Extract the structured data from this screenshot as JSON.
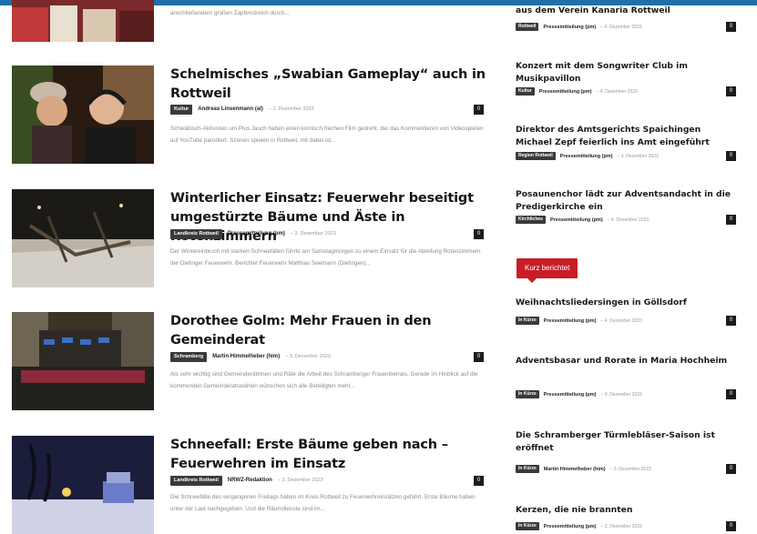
{
  "top_article_excerpt": "anschließendem großen Zapfenstreich durch...",
  "articles": [
    {
      "title": "Schelmisches „Swabian Gameplay“ auch in Rottweil",
      "category": "Kultur",
      "author": "Andreas Linsenmann (al)",
      "date": "3. Dezember 2023",
      "comments": "0",
      "excerpt": "Schwäbisch-Aktivisten um Plus Jauch haben einen komisch-frechen Film gedreht, der das Kommentieren von Videospielen auf YouTube parodiert. Szenen spielen in Rottweil, mit dabei ist..."
    },
    {
      "title": "Winterlicher Einsatz: Feuerwehr beseitigt umgestürzte Bäume und Äste in Rotenzimmern",
      "category": "Landkreis Rottweil",
      "author": "Pressemitteilung (pm)",
      "date": "3. Dezember 2023",
      "comments": "0",
      "excerpt": "Der Wintereinbruch mit starken Schneefällen führte am Samstagmorgen zu einem Einsatz für die Abteilung Rotenzimmern der Dietinger Feuerwehr. Berichtet Feuerwehr Matthias Seemann (Dietingen)..."
    },
    {
      "title": "Dorothee Golm: Mehr Frauen in den Gemeinderat",
      "category": "Schramberg",
      "author": "Martin Himmelheber (him)",
      "date": "3. Dezember 2023",
      "comments": "0",
      "excerpt": "Als sehr wichtig sind Gemeinderätinnen und Räte die Arbeit des Schramberger Frauenbeirats. Gerade im Hinblick auf die kommenden Gemeinderatswahlen wünschen sich alle Beteiligten mehr..."
    },
    {
      "title": "Schneefall: Erste Bäume geben nach – Feuerwehren im Einsatz",
      "category": "Landkreis Rottweil",
      "author": "NRWZ-Redaktion",
      "date": "3. Dezember 2023",
      "comments": "0",
      "excerpt": "Die Schneefälle des vergangenen Freitags haben im Kreis Rottweil zu Feuerwehreinsätzen geführt. Erste Bäume haben unter der Last nachgegeben. Und die Räumdienste sind im..."
    }
  ],
  "sidebar": [
    {
      "title": "aus dem Verein Kanaria Rottweil",
      "category": "Rottweil",
      "author": "Pressemitteilung (pm)",
      "date": "4. Dezember 2023",
      "comments": "0"
    },
    {
      "title": "Konzert mit dem Songwriter Club im Musikpavillon",
      "category": "Kultur",
      "author": "Pressemitteilung (pm)",
      "date": "4. Dezember 2023",
      "comments": "0"
    },
    {
      "title": "Direktor des Amtsgerichts Spaichingen Michael Zepf feierlich ins Amt eingeführt",
      "category": "Region Rottweil",
      "author": "Pressemitteilung (pm)",
      "date": "3. Dezember 2023",
      "comments": "0"
    },
    {
      "title": "Posaunenchor lädt zur Adventsandacht in die Predigerkirche ein",
      "category": "Kirchliches",
      "author": "Pressemitteilung (pm)",
      "date": "4. Dezember 2023",
      "comments": "0"
    }
  ],
  "kurz_label": "Kurz berichtet",
  "kurz_items": [
    {
      "title": "Weihnachtsliedersingen in Göllsdorf",
      "category": "In Kürze",
      "author": "Pressemitteilung (pm)",
      "date": "4. Dezember 2023",
      "comments": "0"
    },
    {
      "title": "Adventsbasar und Rorate in Maria Hochheim",
      "category": "In Kürze",
      "author": "Pressemitteilung (pm)",
      "date": "4. Dezember 2023",
      "comments": "0"
    },
    {
      "title": "Die Schramberger Türmlebläser-Saison ist eröffnet",
      "category": "In Kürze",
      "author": "Martin Himmelheber (him)",
      "date": "3. Dezember 2023",
      "comments": "0"
    },
    {
      "title": "Kerzen, die nie brannten",
      "category": "In Kürze",
      "author": "Pressemitteilung (pm)",
      "date": "3. Dezember 2023",
      "comments": "0"
    }
  ],
  "colors": {
    "top_bar": "#1f6fa8",
    "kurz_badge": "#c81d25",
    "category_badge": "#3a3a3a",
    "comment_box": "#1c1c1c"
  }
}
